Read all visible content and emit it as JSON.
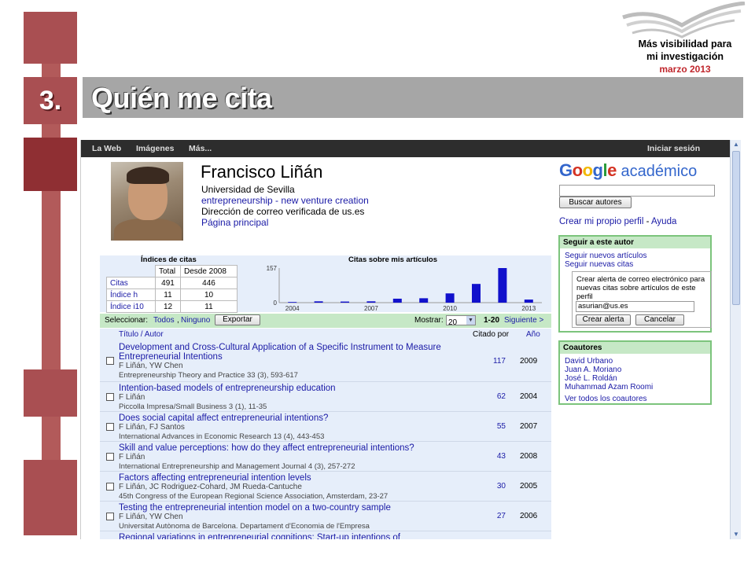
{
  "slide": {
    "number": "3.",
    "title": "Quién me cita",
    "brand_line1": "Más visibilidad para",
    "brand_line2": "mi investigación",
    "date": "marzo 2013"
  },
  "gbar": {
    "web": "La Web",
    "images": "Imágenes",
    "more": "Más...",
    "signin": "Iniciar sesión"
  },
  "profile": {
    "name": "Francisco Liñán",
    "affiliation": "Universidad de Sevilla",
    "interests": "entrepreneurship - new venture creation",
    "email_verified": "Dirección de correo verificada de us.es",
    "homepage": "Página principal"
  },
  "right": {
    "logo_google": "Google",
    "logo_academico": "académico",
    "search_button": "Buscar autores",
    "create_profile": "Crear mi propio perfil",
    "help": "Ayuda",
    "follow_header": "Seguir a este autor",
    "follow_articles": "Seguir nuevos artículos",
    "follow_citations": "Seguir nuevas citas",
    "alert_text": "Crear alerta de correo electrónico para nuevas citas sobre artículos de este perfil",
    "alert_email": "asurian@us.es",
    "create_alert": "Crear alerta",
    "cancel": "Cancelar",
    "coauthors_header": "Coautores",
    "coauthors": [
      "David Urbano",
      "Juan A. Moriano",
      "José L. Roldán",
      "Muhammad Azam Roomi"
    ],
    "all_coauthors": "Ver todos los coautores"
  },
  "indices": {
    "title": "Índices de citas",
    "col_total": "Total",
    "col_since": "Desde 2008",
    "rows": [
      {
        "label": "Citas",
        "total": "491",
        "since": "446"
      },
      {
        "label": "Índice h",
        "total": "11",
        "since": "10"
      },
      {
        "label": "Índice i10",
        "total": "12",
        "since": "11"
      }
    ]
  },
  "chart_data": {
    "type": "bar",
    "title": "Citas sobre mis artículos",
    "x": [
      2004,
      2005,
      2006,
      2007,
      2008,
      2009,
      2010,
      2011,
      2012,
      2013
    ],
    "values": [
      3,
      6,
      5,
      6,
      18,
      20,
      42,
      85,
      157,
      14
    ],
    "ylim": [
      0,
      157
    ],
    "yticks": [
      "157",
      "0"
    ],
    "xticks": [
      "2004",
      "2007",
      "2010",
      "2013"
    ],
    "color": "#1111cc"
  },
  "list": {
    "select_label": "Seleccionar:",
    "select_all": "Todos",
    "select_none": "Ninguno",
    "export": "Exportar",
    "show_label": "Mostrar:",
    "show_value": "20",
    "range": "1-20",
    "next": "Siguiente >",
    "col_title": "Título / Autor",
    "col_cited": "Citado por",
    "col_year": "Año",
    "articles": [
      {
        "title": "Development and Cross-Cultural Application of a Specific Instrument to Measure Entrepreneurial Intentions",
        "authors": "F Liñán, YW Chen",
        "journal": "Entrepreneurship Theory and Practice 33 (3), 593-617",
        "cited": "117",
        "year": "2009"
      },
      {
        "title": "Intention-based models of entrepreneurship education",
        "authors": "F Liñán",
        "journal": "Piccolla Impresa/Small Business 3 (1), 11-35",
        "cited": "62",
        "year": "2004"
      },
      {
        "title": "Does social capital affect entrepreneurial intentions?",
        "authors": "F Liñán, FJ Santos",
        "journal": "International Advances in Economic Research 13 (4), 443-453",
        "cited": "55",
        "year": "2007"
      },
      {
        "title": "Skill and value perceptions: how do they affect entrepreneurial intentions?",
        "authors": "F Liñán",
        "journal": "International Entrepreneurship and Management Journal 4 (3), 257-272",
        "cited": "43",
        "year": "2008"
      },
      {
        "title": "Factors affecting entrepreneurial intention levels",
        "authors": "F Liñán, JC Rodriguez-Cohard, JM Rueda-Cantuche",
        "journal": "45th Congress of the European Regional Science Association, Amsterdam, 23-27",
        "cited": "30",
        "year": "2005"
      },
      {
        "title": "Testing the entrepreneurial intention model on a two-country sample",
        "authors": "F Liñán, YW Chen",
        "journal": "Universitat Autònoma de Barcelona. Departament d'Economia de l'Empresa",
        "cited": "27",
        "year": "2006"
      },
      {
        "title": "Regional variations in entrepreneurial cognitions: Start-up intentions of",
        "authors": "",
        "journal": "",
        "cited": "",
        "year": ""
      }
    ]
  }
}
